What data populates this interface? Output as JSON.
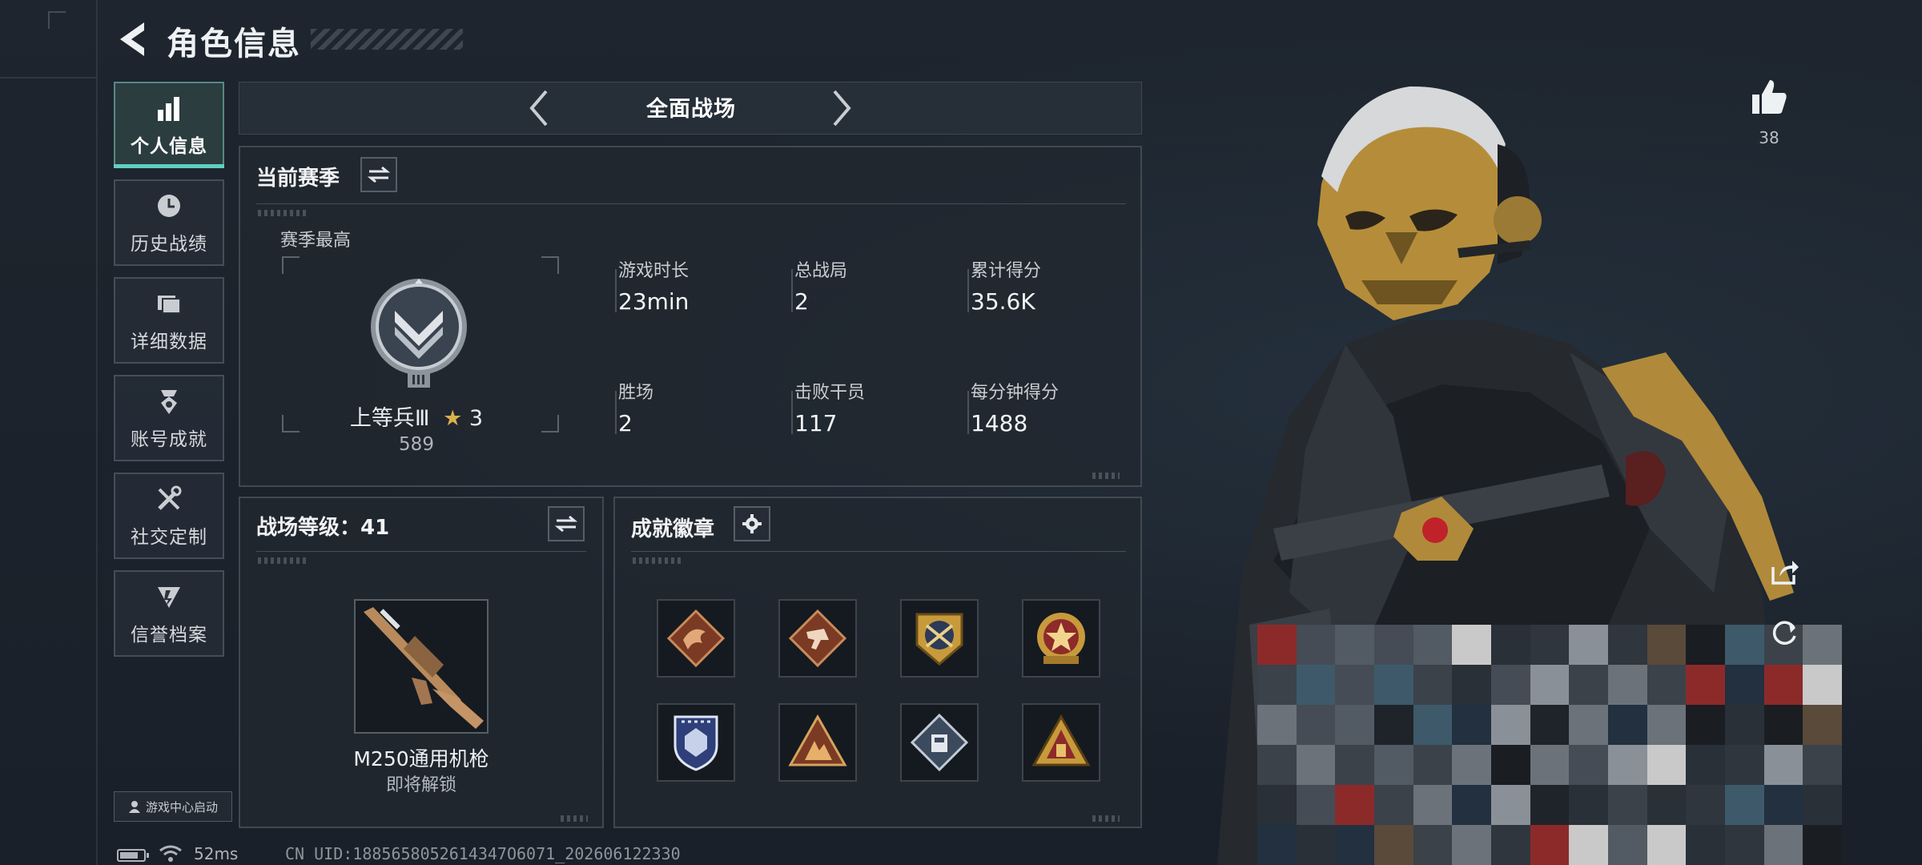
{
  "header": {
    "title": "角色信息"
  },
  "sidebar": {
    "items": [
      {
        "label": "个人信息",
        "icon": "bar-chart-icon",
        "active": true
      },
      {
        "label": "历史战绩",
        "icon": "clock-icon",
        "active": false
      },
      {
        "label": "详细数据",
        "icon": "folder-icon",
        "active": false
      },
      {
        "label": "账号成就",
        "icon": "medal-icon",
        "active": false
      },
      {
        "label": "社交定制",
        "icon": "tools-icon",
        "active": false
      },
      {
        "label": "信誉档案",
        "icon": "emblem-icon",
        "active": false
      }
    ],
    "launch_label": "游戏中心启动"
  },
  "mode_selector": {
    "title": "全面战场"
  },
  "season": {
    "title": "当前赛季",
    "best_label": "赛季最高",
    "rank_name": "上等兵Ⅲ",
    "rank_stars": "3",
    "rank_score": "589",
    "stats": [
      {
        "label": "游戏时长",
        "value": "23min"
      },
      {
        "label": "总战局",
        "value": "2"
      },
      {
        "label": "累计得分",
        "value": "35.6K"
      },
      {
        "label": "胜场",
        "value": "2"
      },
      {
        "label": "击败干员",
        "value": "117"
      },
      {
        "label": "每分钟得分",
        "value": "1488"
      }
    ]
  },
  "battle_level": {
    "title": "战场等级：41",
    "weapon_name": "M250通用机枪",
    "weapon_status": "即将解锁"
  },
  "achievements": {
    "title": "成就徽章",
    "badges": [
      "dragon-badge-icon",
      "runner-badge-icon",
      "crossed-rifles-badge-icon",
      "star-wreath-badge-icon",
      "shield-badge-icon",
      "tent-badge-icon",
      "diamond-badge-icon",
      "pyramid-badge-icon"
    ]
  },
  "status_bar": {
    "ping": "52ms",
    "uid": "CN UID:1885658052614347O6071_202606122330"
  },
  "social": {
    "likes": "38"
  },
  "colors": {
    "accent": "#5fd0bf",
    "background": "#1b222b",
    "gold": "#c9a04a"
  }
}
